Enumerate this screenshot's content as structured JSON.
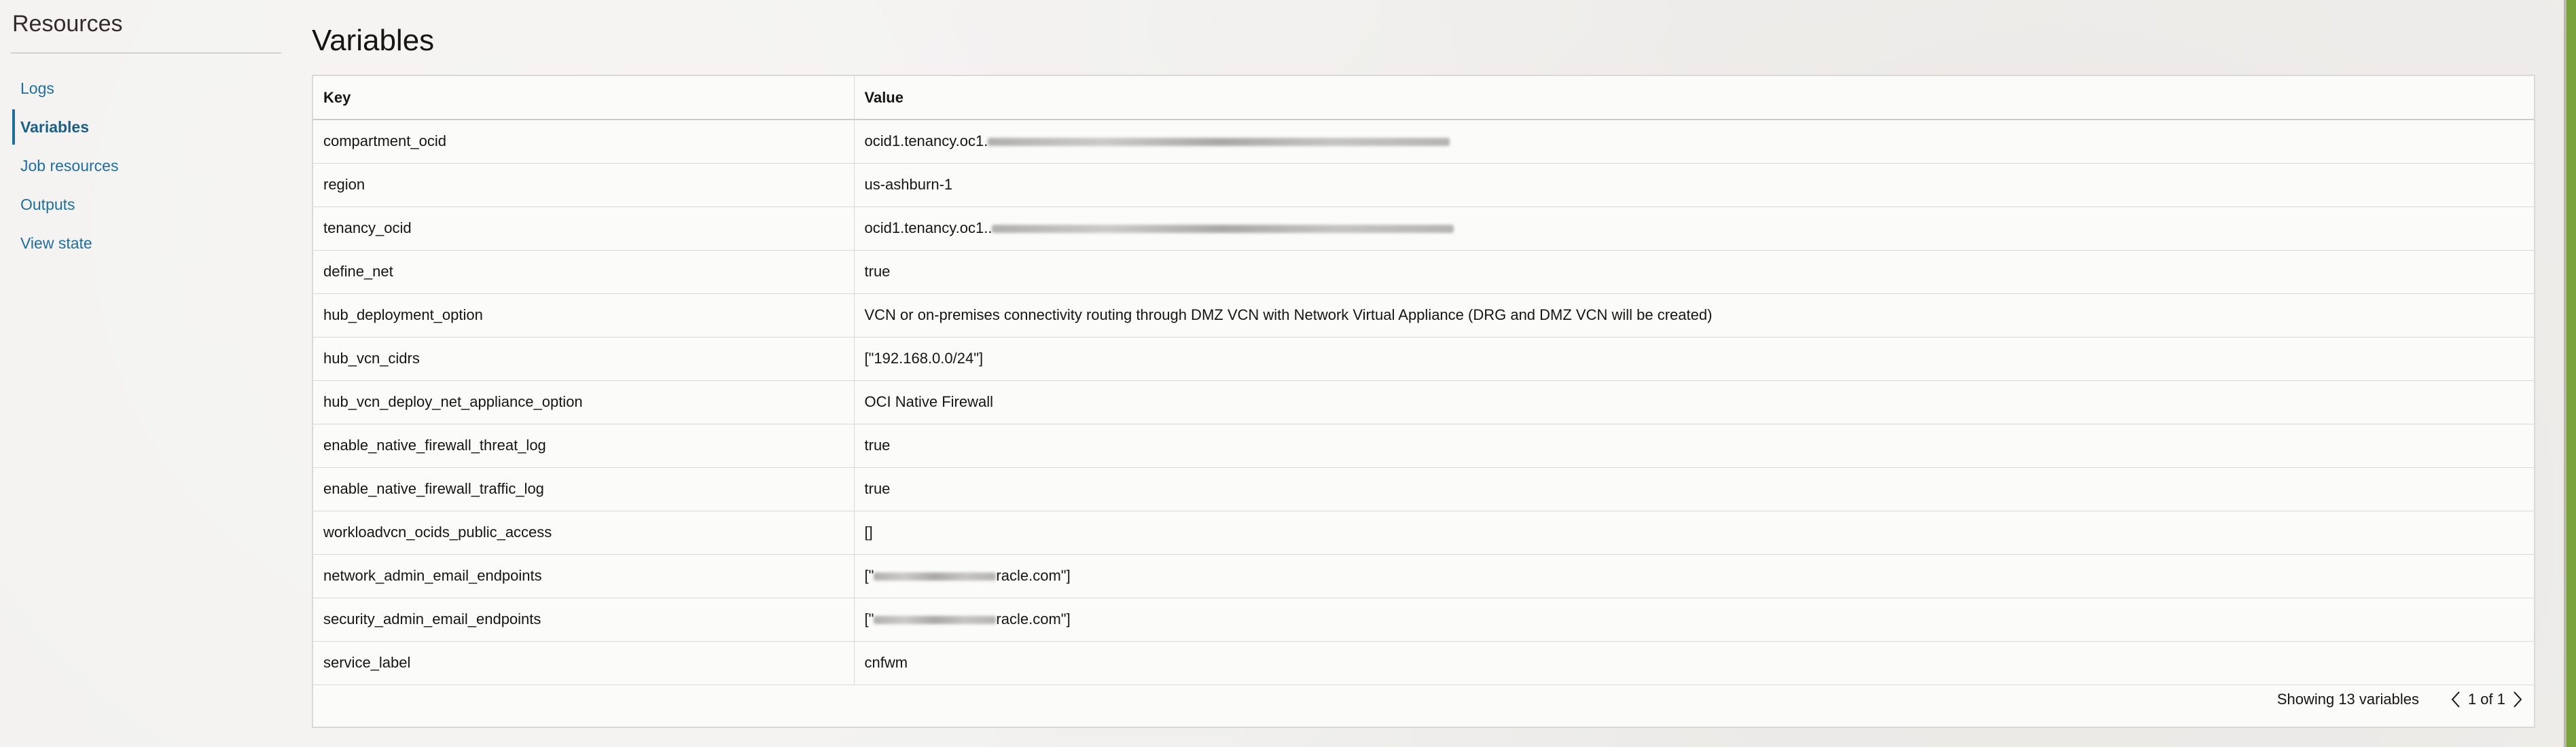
{
  "sidebar": {
    "title": "Resources",
    "items": [
      {
        "label": "Logs",
        "active": false
      },
      {
        "label": "Variables",
        "active": true
      },
      {
        "label": "Job resources",
        "active": false
      },
      {
        "label": "Outputs",
        "active": false
      },
      {
        "label": "View state",
        "active": false
      }
    ]
  },
  "main": {
    "title": "Variables",
    "table": {
      "columns": [
        "Key",
        "Value"
      ],
      "rows": [
        {
          "key": "compartment_ocid",
          "value": "ocid1.tenancy.oc1.",
          "redacted_suffix": true
        },
        {
          "key": "region",
          "value": "us-ashburn-1"
        },
        {
          "key": "tenancy_ocid",
          "value": "ocid1.tenancy.oc1..",
          "redacted_suffix": true
        },
        {
          "key": "define_net",
          "value": "true"
        },
        {
          "key": "hub_deployment_option",
          "value": "VCN or on-premises connectivity routing through DMZ VCN with Network Virtual Appliance (DRG and DMZ VCN will be created)"
        },
        {
          "key": "hub_vcn_cidrs",
          "value": "[\"192.168.0.0/24\"]"
        },
        {
          "key": "hub_vcn_deploy_net_appliance_option",
          "value": "OCI Native Firewall"
        },
        {
          "key": "enable_native_firewall_threat_log",
          "value": "true"
        },
        {
          "key": "enable_native_firewall_traffic_log",
          "value": "true"
        },
        {
          "key": "workloadvcn_ocids_public_access",
          "value": "[]"
        },
        {
          "key": "network_admin_email_endpoints",
          "value_prefix": "[\"",
          "value_suffix": "racle.com\"]",
          "redacted_middle": true
        },
        {
          "key": "security_admin_email_endpoints",
          "value_prefix": "[\"",
          "value_suffix": "racle.com\"]",
          "redacted_middle": true
        },
        {
          "key": "service_label",
          "value": "cnfwm"
        }
      ]
    },
    "footer": {
      "count_text": "Showing 13 variables",
      "page_info": "1 of 1",
      "prev_icon": "chevron-left-icon",
      "next_icon": "chevron-right-icon"
    }
  },
  "colors": {
    "link": "#1f6f9e",
    "accent_strip": "#7aa33c",
    "background": "#f1f0ee"
  }
}
